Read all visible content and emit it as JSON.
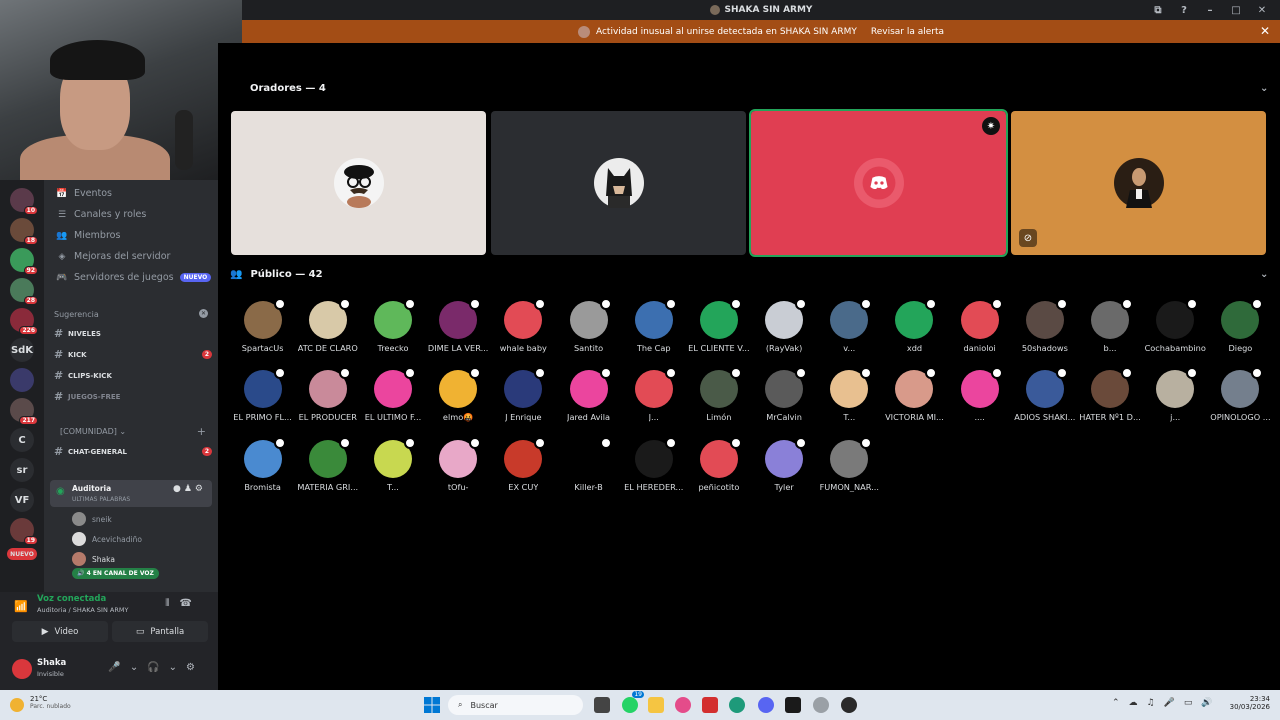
{
  "window": {
    "title": "SHAKA SIN ARMY",
    "controls": [
      "⧉",
      "?",
      "–",
      "□",
      "✕"
    ]
  },
  "alert": {
    "message": "Actividad inusual al unirse detectada en SHAKA SIN ARMY",
    "action": "Revisar la alerta",
    "close": "✕"
  },
  "stage": {
    "speakers_header": "Oradores — 4",
    "audience_header": "Público — 42",
    "speakers": [
      {
        "bg": "#e6e0dc",
        "avatar_bg": "#f2f2f2",
        "selected": false,
        "pin": false,
        "nocam": false
      },
      {
        "bg": "#2b2d31",
        "avatar_bg": "#e8e8e8",
        "selected": false,
        "pin": false,
        "nocam": false
      },
      {
        "bg": "#e03e52",
        "avatar_bg": "#f06478",
        "selected": true,
        "pin": true,
        "nocam": false
      },
      {
        "bg": "#d38f41",
        "avatar_bg": "#3a2a1c",
        "selected": false,
        "pin": false,
        "nocam": true
      }
    ],
    "audience": [
      {
        "name": "SpartacUs",
        "color": "#8a6a48"
      },
      {
        "name": "ATC DE CLARO",
        "color": "#d8c9a8"
      },
      {
        "name": "Treecko",
        "color": "#5fb85a"
      },
      {
        "name": "DIME LA VER...",
        "color": "#7a2a6a"
      },
      {
        "name": "whale baby",
        "color": "#e24b55"
      },
      {
        "name": "Santito",
        "color": "#9a9a9a"
      },
      {
        "name": "The Cap",
        "color": "#3c6fb0"
      },
      {
        "name": "EL CLIENTE V...",
        "color": "#23a55a"
      },
      {
        "name": "(RayVak)",
        "color": "#c9cdd4"
      },
      {
        "name": "v...",
        "color": "#4a6a8a"
      },
      {
        "name": "xdd",
        "color": "#23a55a"
      },
      {
        "name": "danioloi",
        "color": "#e24b55"
      },
      {
        "name": "50shadows",
        "color": "#5a4a44"
      },
      {
        "name": "b...",
        "color": "#6a6a6a"
      },
      {
        "name": "Cochabambino",
        "color": "#1a1a1a"
      },
      {
        "name": "Diego",
        "color": "#2f6a3a"
      },
      {
        "name": "EL PRIMO FL...",
        "color": "#2a4a8a"
      },
      {
        "name": "EL PRODUCER",
        "color": "#c98a9a"
      },
      {
        "name": "EL ULTIMO F...",
        "color": "#eb459e"
      },
      {
        "name": "elmo🤬",
        "color": "#f0b232"
      },
      {
        "name": "J Enrique",
        "color": "#2a3a7a"
      },
      {
        "name": "Jared Avila",
        "color": "#eb459e"
      },
      {
        "name": "J...",
        "color": "#e24b55"
      },
      {
        "name": "Limón",
        "color": "#4a5a48"
      },
      {
        "name": "MrCalvin",
        "color": "#5a5a5a"
      },
      {
        "name": "T...",
        "color": "#e8c090"
      },
      {
        "name": "VICTORIA MI...",
        "color": "#d89a8a"
      },
      {
        "name": "....",
        "color": "#eb459e"
      },
      {
        "name": "ADIOS SHAKI...",
        "color": "#3a5a9a"
      },
      {
        "name": "HATER Nº1 D...",
        "color": "#6a4a3a"
      },
      {
        "name": "j...",
        "color": "#b8b0a0"
      },
      {
        "name": "OPINOLOGO ...",
        "color": "#747f8d"
      },
      {
        "name": "Bromista",
        "color": "#4a8ad0"
      },
      {
        "name": "MATERIA GRI...",
        "color": "#3a8a3a"
      },
      {
        "name": "T...",
        "color": "#c8d850"
      },
      {
        "name": "tOfu-",
        "color": "#e8a8c8"
      },
      {
        "name": "EX CUY",
        "color": "#c83a2a"
      },
      {
        "name": "Killer-B",
        "color": "#000000"
      },
      {
        "name": "EL HEREDER...",
        "color": "#1a1a1a"
      },
      {
        "name": "peñicotito",
        "color": "#e24b55"
      },
      {
        "name": "Tyler",
        "color": "#8a80d8"
      },
      {
        "name": "FUMON_NAR...",
        "color": "#7a7a7a"
      }
    ]
  },
  "sidebar": {
    "menu": [
      {
        "label": "Eventos",
        "icon": "📅"
      },
      {
        "label": "Canales y roles",
        "icon": "☰"
      },
      {
        "label": "Miembros",
        "icon": "👥"
      },
      {
        "label": "Mejoras del servidor",
        "icon": "◈"
      },
      {
        "label": "Servidores de juegos",
        "icon": "🎮",
        "tag": "NUEVO"
      }
    ],
    "suggestion_label": "Sugerencia",
    "suggested": [
      {
        "label": "NIVELES",
        "badge": ""
      },
      {
        "label": "KICK",
        "badge": "2"
      },
      {
        "label": "CLIPS-KICK",
        "badge": ""
      },
      {
        "label": "JUEGOS-FREE",
        "badge": ""
      }
    ],
    "community_label": "[COMUNIDAD]",
    "community_channels": [
      {
        "label": "CHAT-GENERAL",
        "badge": "2"
      }
    ],
    "voice_channel": {
      "name": "Auditoria",
      "status": "ULTIMAS PALABRAS"
    },
    "voice_users": [
      "sneik",
      "Acevichadiño",
      "Shaka"
    ],
    "in_call": "4 EN CANAL DE VOZ"
  },
  "servers": [
    {
      "label": "",
      "badge": "10",
      "color": "#5a3a4a"
    },
    {
      "label": "",
      "badge": "18",
      "color": "#6a4a3a"
    },
    {
      "label": "",
      "badge": "92",
      "color": "#3a9a5a"
    },
    {
      "label": "",
      "badge": "28",
      "color": "#4a7a5a"
    },
    {
      "label": "",
      "badge": "226",
      "color": "#8a2a3a"
    },
    {
      "label": "SdK",
      "badge": "",
      "color": "#2b2d31"
    },
    {
      "label": "",
      "badge": "",
      "color": "#3a3a6a"
    },
    {
      "label": "",
      "badge": "217",
      "color": "#5a4a4a"
    },
    {
      "label": "C",
      "badge": "",
      "color": "#2b2d31"
    },
    {
      "label": "sr",
      "badge": "",
      "color": "#2b2d31"
    },
    {
      "label": "VF",
      "badge": "",
      "color": "#2b2d31"
    },
    {
      "label": "",
      "badge": "19",
      "color": "#6a3a3a"
    },
    {
      "label": "NUEVO",
      "badge": "",
      "color": "#da373c"
    }
  ],
  "voice_panel": {
    "status": "Voz conectada",
    "location": "Auditoria / SHAKA SIN ARMY",
    "video_label": "Video",
    "screen_label": "Pantalla",
    "user_name": "Shaka",
    "user_status": "Invisible"
  },
  "taskbar": {
    "temperature": "21°C",
    "weather": "Parc. nublado",
    "search_placeholder": "Buscar",
    "time": "23:34",
    "date": "30/03/2026",
    "app_badge": "19"
  }
}
